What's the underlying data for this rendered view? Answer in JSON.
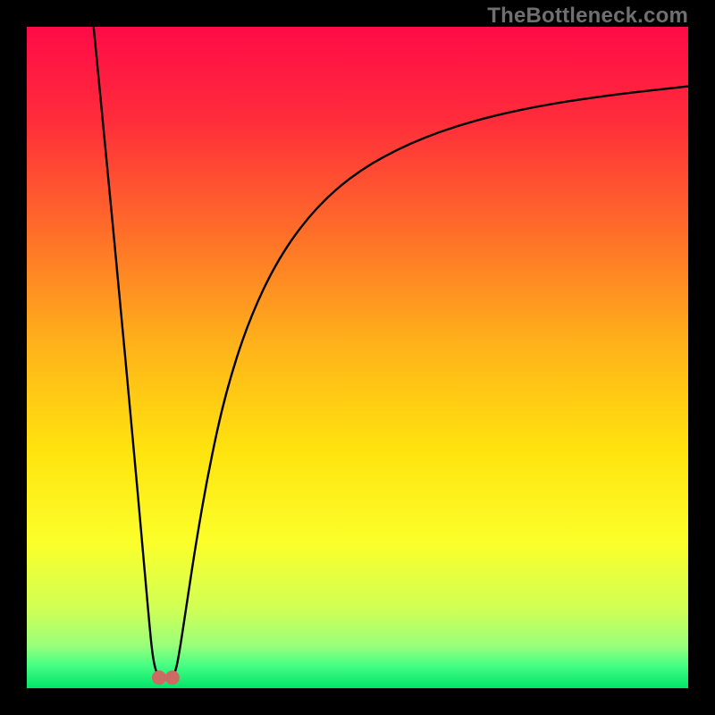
{
  "watermark": "TheBottleneck.com",
  "colors": {
    "frame": "#000000",
    "marker": "#cb6b63",
    "curve": "#000000",
    "gradient_stops": [
      {
        "offset": 0.0,
        "color": "#ff0b47"
      },
      {
        "offset": 0.14,
        "color": "#ff2c3b"
      },
      {
        "offset": 0.3,
        "color": "#ff6a2a"
      },
      {
        "offset": 0.48,
        "color": "#ffb21a"
      },
      {
        "offset": 0.64,
        "color": "#ffe30e"
      },
      {
        "offset": 0.78,
        "color": "#fbff2a"
      },
      {
        "offset": 0.88,
        "color": "#d0ff55"
      },
      {
        "offset": 0.935,
        "color": "#9aff7a"
      },
      {
        "offset": 0.965,
        "color": "#48ff84"
      },
      {
        "offset": 1.0,
        "color": "#00e46a"
      }
    ]
  },
  "chart_data": {
    "type": "line",
    "title": "",
    "xlabel": "",
    "ylabel": "",
    "xlim": [
      0,
      100
    ],
    "ylim": [
      0,
      100
    ],
    "series": [
      {
        "name": "left-branch",
        "x": [
          10.1,
          12.0,
          14.0,
          16.0,
          17.4,
          18.5,
          19.0,
          19.5,
          20.0
        ],
        "values": [
          100.0,
          80.5,
          59.5,
          38.0,
          22.5,
          10.0,
          5.0,
          2.6,
          1.6
        ]
      },
      {
        "name": "right-branch",
        "x": [
          22.0,
          22.5,
          23.0,
          24.0,
          25.5,
          27.5,
          30.0,
          33.5,
          38.0,
          43.5,
          50.0,
          58.0,
          67.0,
          77.5,
          89.0,
          100.0
        ],
        "values": [
          1.6,
          2.6,
          5.0,
          11.5,
          21.5,
          33.0,
          44.5,
          55.5,
          65.0,
          72.5,
          78.2,
          82.5,
          85.7,
          88.1,
          89.8,
          91.0
        ]
      },
      {
        "name": "valley-floor",
        "x": [
          20.0,
          20.5,
          21.0,
          21.5,
          22.0
        ],
        "values": [
          1.6,
          1.35,
          1.3,
          1.35,
          1.6
        ]
      }
    ],
    "markers": [
      {
        "name": "valley-left",
        "x": 20.0,
        "y": 1.6
      },
      {
        "name": "valley-right",
        "x": 22.0,
        "y": 1.6
      }
    ]
  }
}
